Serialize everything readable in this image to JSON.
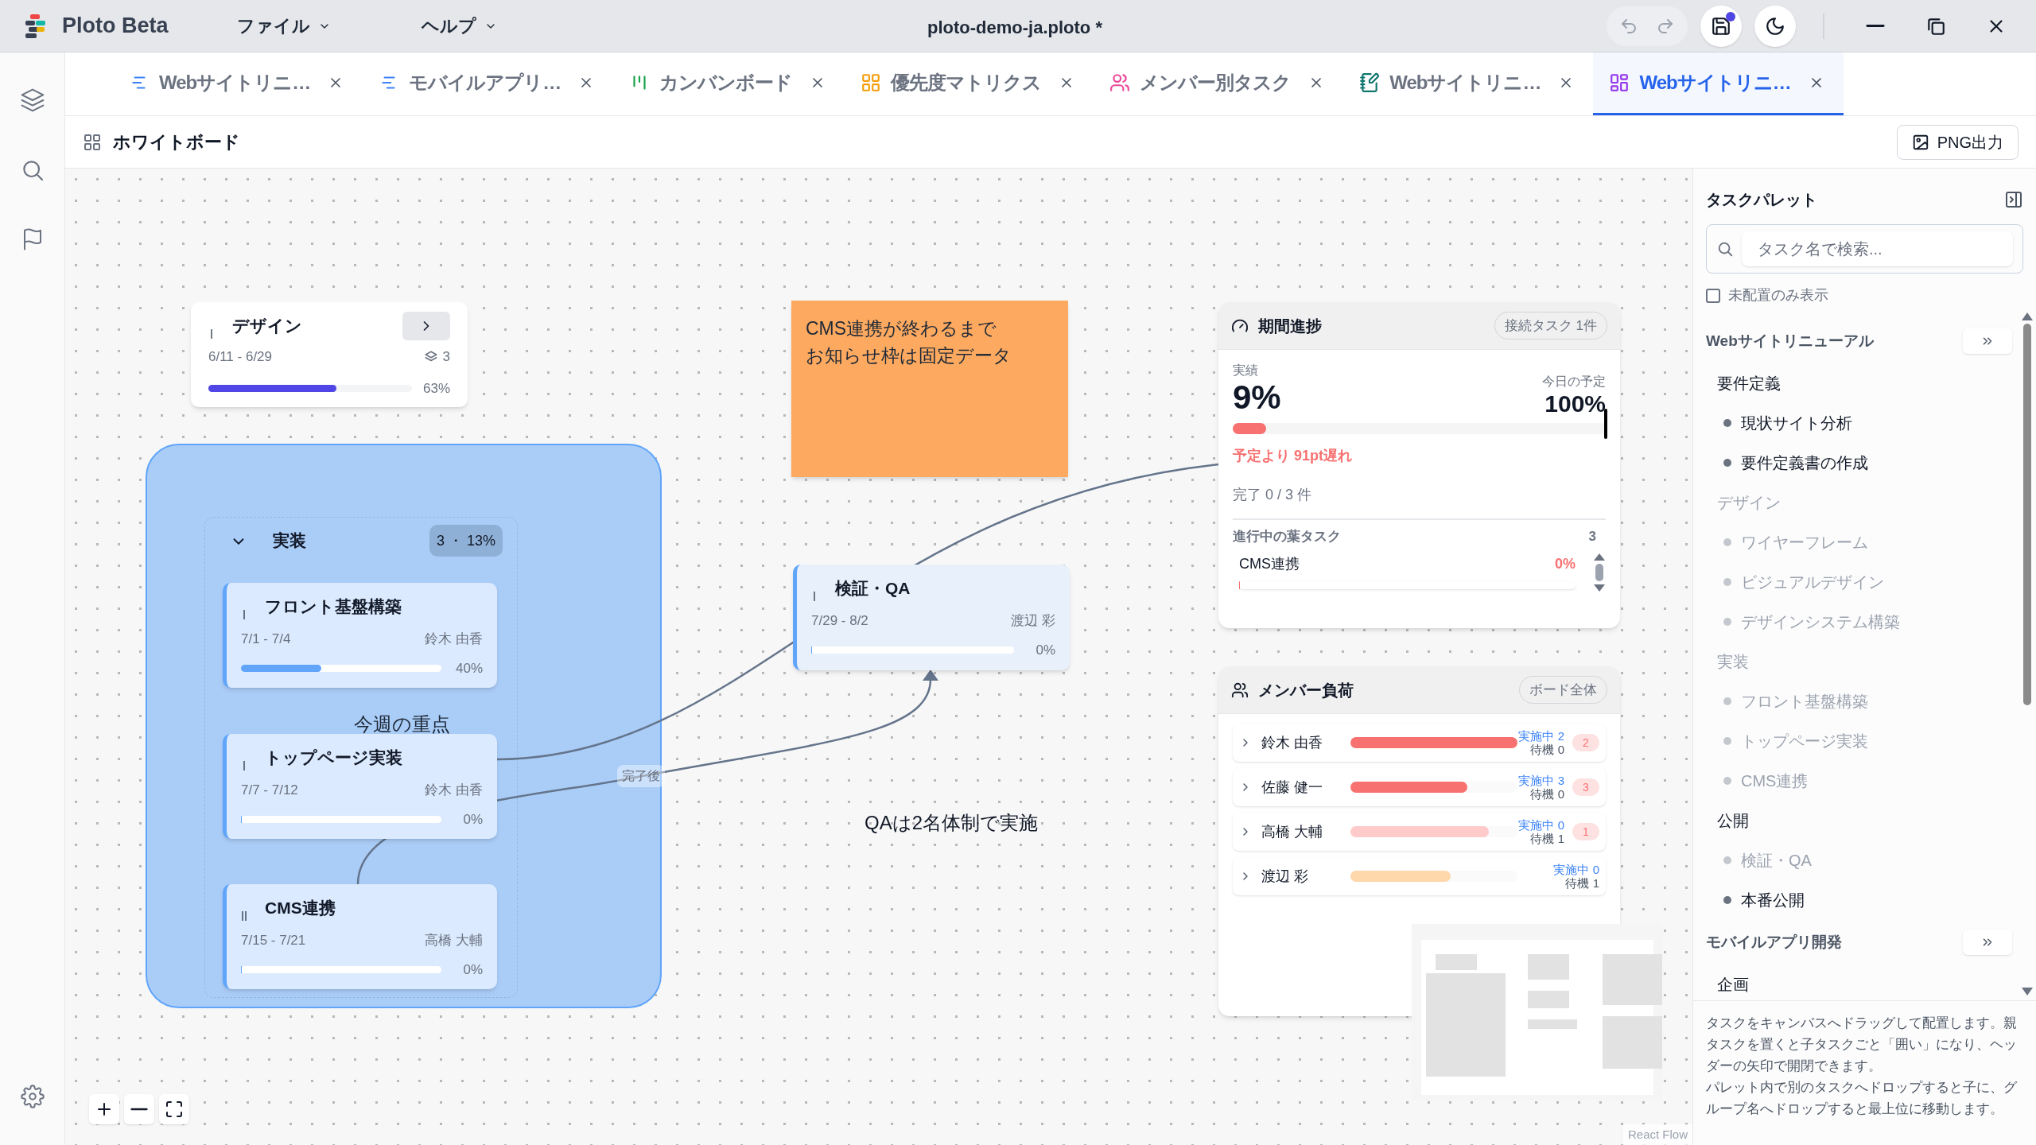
{
  "app": {
    "name": "Ploto Beta",
    "menus": [
      {
        "label": "ファイル"
      },
      {
        "label": "ヘルプ"
      }
    ],
    "title": "ploto-demo-ja.ploto *",
    "unsaved": true
  },
  "tabs": [
    {
      "label": "Webサイトリニ…",
      "kind": "gantt",
      "color": "#3b82f6",
      "selected": false
    },
    {
      "label": "モバイルアプリ…",
      "kind": "gantt",
      "color": "#3b82f6",
      "selected": false
    },
    {
      "label": "カンバンボード",
      "kind": "kanban",
      "color": "#16a34a",
      "selected": false
    },
    {
      "label": "優先度マトリクス",
      "kind": "matrix",
      "color": "#f59e0b",
      "selected": false
    },
    {
      "label": "メンバー別タスク",
      "kind": "members",
      "color": "#ec4899",
      "selected": false
    },
    {
      "label": "Webサイトリニ…",
      "kind": "notebook",
      "color": "#0f766e",
      "selected": false
    },
    {
      "label": "Webサイトリニ…",
      "kind": "board",
      "color": "#9333ea",
      "selected": true
    }
  ],
  "toolbar": {
    "title": "ホワイトボード",
    "export_button": "PNG出力"
  },
  "canvas": {
    "parent_card": {
      "title": "デザイン",
      "dates": "6/11 - 6/29",
      "child_count": "3",
      "level": 0.63,
      "percent": "63%"
    },
    "group": {
      "title": "実装",
      "expanded": true,
      "badge": "3 ・ 13%",
      "tasks": [
        {
          "title": "フロント基盤構築",
          "dates": "7/1 - 7/4",
          "assignee": "鈴木 由香",
          "level": 0.4,
          "percent": "40%",
          "kind": "single"
        },
        {
          "title": "トップページ実装",
          "dates": "7/7 - 7/12",
          "assignee": "鈴木 由香",
          "level": 0,
          "percent": "0%",
          "kind": "single"
        },
        {
          "title": "CMS連携",
          "dates": "7/15 - 7/21",
          "assignee": "高橋 大輔",
          "level": 0,
          "percent": "0%",
          "kind": "double"
        }
      ]
    },
    "frame_label": "今週の重点",
    "sticky_note": {
      "lines": [
        "CMS連携が終わるまで",
        "お知らせ枠は固定データ"
      ]
    },
    "qa_card": {
      "title": "検証・QA",
      "dates": "7/29 - 8/2",
      "assignee": "渡辺 彩",
      "level": 0,
      "percent": "0%",
      "kind": "single"
    },
    "edge_label": "完了後",
    "text_note": "QAは2名体制で実施",
    "progress_widget": {
      "title": "期間進捗",
      "badge": "接続タスク 1件",
      "actual": {
        "label": "実績",
        "value": "9%",
        "level": 0.09
      },
      "planned": {
        "label": "今日の予定",
        "value": "100%",
        "level": 1
      },
      "delay": "予定より 91pt遅れ",
      "done": "完了 0 / 3 件",
      "leaf_title": "進行中の葉タスク",
      "leaf_count": "3",
      "leaf_tasks": [
        {
          "name": "CMS連携",
          "percent": "0%",
          "level": 0
        }
      ]
    },
    "member_widget": {
      "title": "メンバー負荷",
      "badge": "ボード全体",
      "members": [
        {
          "name": "鈴木 由香",
          "level": 1,
          "color": "#f87171",
          "active_label": "実施中",
          "active": "2",
          "waiting_label": "待機",
          "waiting": "0",
          "alert": "2"
        },
        {
          "name": "佐藤 健一",
          "level": 0.7,
          "color": "#f87171",
          "active_label": "実施中",
          "active": "3",
          "waiting_label": "待機",
          "waiting": "0",
          "alert": "3"
        },
        {
          "name": "高橋 大輔",
          "level": 0.83,
          "color": "#fecaca",
          "active_label": "実施中",
          "active": "0",
          "waiting_label": "待機",
          "waiting": "1",
          "alert": "1"
        },
        {
          "name": "渡辺 彩",
          "level": 0.6,
          "color": "#fed7aa",
          "active_label": "実施中",
          "active": "0",
          "waiting_label": "待機",
          "waiting": "1"
        }
      ]
    },
    "attribution": "React Flow"
  },
  "palette": {
    "title": "タスクパレット",
    "search_placeholder": "タスク名で検索...",
    "unplaced_only": {
      "label": "未配置のみ表示",
      "checked": false
    },
    "groups": [
      {
        "name": "Webサイトリニューアル",
        "tasks": [
          {
            "label": "要件定義",
            "placed": false,
            "children": [
              {
                "label": "現状サイト分析",
                "placed": false
              },
              {
                "label": "要件定義書の作成",
                "placed": false
              }
            ]
          },
          {
            "label": "デザイン",
            "placed": true,
            "children": [
              {
                "label": "ワイヤーフレーム",
                "placed": true
              },
              {
                "label": "ビジュアルデザイン",
                "placed": true
              },
              {
                "label": "デザインシステム構築",
                "placed": true
              }
            ]
          },
          {
            "label": "実装",
            "placed": true,
            "children": [
              {
                "label": "フロント基盤構築",
                "placed": true
              },
              {
                "label": "トップページ実装",
                "placed": true
              },
              {
                "label": "CMS連携",
                "placed": true
              }
            ]
          },
          {
            "label": "公開",
            "placed": false,
            "children": [
              {
                "label": "検証・QA",
                "placed": true
              },
              {
                "label": "本番公開",
                "placed": false
              }
            ]
          }
        ]
      },
      {
        "name": "モバイルアプリ開発",
        "tasks": [
          {
            "label": "企画",
            "placed": false
          }
        ]
      }
    ],
    "help": [
      "タスクをキャンバスへドラッグして配置します。親タスクを置くと子タスクごと「囲い」になり、ヘッダーの矢印で開閉できます。",
      "パレット内で別のタスクへドロップすると子に、グループ名へドロップすると最上位に移動します。"
    ]
  }
}
